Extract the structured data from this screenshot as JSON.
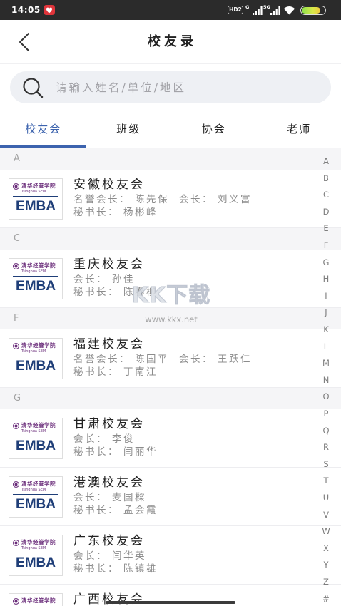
{
  "status_bar": {
    "time": "14:05",
    "notification_icon": "heart-icon",
    "hd_badge": "HD2",
    "sim1_network": "G",
    "sim1_signal_bars": 4,
    "sim2_network": "5G",
    "sim2_signal_bars": 4,
    "wifi_icon": "wifi-icon",
    "battery_level": 0.8
  },
  "header": {
    "title": "校友录",
    "back_icon": "chevron-left-icon"
  },
  "search": {
    "icon": "search-icon",
    "placeholder": "请输入姓名/单位/地区",
    "value": ""
  },
  "tabs": [
    {
      "label": "校友会",
      "active": true
    },
    {
      "label": "班级",
      "active": false
    },
    {
      "label": "协会",
      "active": false
    },
    {
      "label": "老师",
      "active": false
    }
  ],
  "logo": {
    "school": "清华经管学院",
    "english": "Tsinghua SEM",
    "program": "EMBA"
  },
  "sections": [
    {
      "letter": "A",
      "items": [
        {
          "name": "安徽校友会",
          "rows": [
            [
              {
                "label": "名誉会长：",
                "value": "陈先保"
              },
              {
                "label": "会长：",
                "value": "刘义富"
              }
            ],
            [
              {
                "label": "秘书长：",
                "value": "杨彬峰"
              }
            ]
          ]
        }
      ]
    },
    {
      "letter": "C",
      "items": [
        {
          "name": "重庆校友会",
          "rows": [
            [
              {
                "label": "会长：",
                "value": "孙佳"
              }
            ],
            [
              {
                "label": "秘书长：",
                "value": "陈春柳"
              }
            ]
          ]
        }
      ]
    },
    {
      "letter": "F",
      "items": [
        {
          "name": "福建校友会",
          "rows": [
            [
              {
                "label": "名誉会长：",
                "value": "陈国平"
              },
              {
                "label": "会长：",
                "value": "王跃仁"
              }
            ],
            [
              {
                "label": "秘书长：",
                "value": "丁南江"
              }
            ]
          ]
        }
      ]
    },
    {
      "letter": "G",
      "items": [
        {
          "name": "甘肃校友会",
          "rows": [
            [
              {
                "label": "会长：",
                "value": "李俊"
              }
            ],
            [
              {
                "label": "秘书长：",
                "value": "闫丽华"
              }
            ]
          ]
        },
        {
          "name": "港澳校友会",
          "rows": [
            [
              {
                "label": "会长：",
                "value": "麦国樑"
              }
            ],
            [
              {
                "label": "秘书长：",
                "value": "孟会霞"
              }
            ]
          ]
        },
        {
          "name": "广东校友会",
          "rows": [
            [
              {
                "label": "会长：",
                "value": "闫华英"
              }
            ],
            [
              {
                "label": "秘书长：",
                "value": "陈镇雄"
              }
            ]
          ]
        },
        {
          "name": "广西校友会",
          "rows": []
        }
      ]
    }
  ],
  "index_letters": [
    "A",
    "B",
    "C",
    "D",
    "E",
    "F",
    "G",
    "H",
    "I",
    "J",
    "K",
    "L",
    "M",
    "N",
    "O",
    "P",
    "Q",
    "R",
    "S",
    "T",
    "U",
    "V",
    "W",
    "X",
    "Y",
    "Z",
    "#"
  ],
  "watermark": {
    "brand": "KK下载",
    "url": "www.kkx.net"
  },
  "colors": {
    "accent": "#3c63ae",
    "status_bar": "#2b2b2b",
    "section_background": "#f5f5f7",
    "search_background": "#eef0f4",
    "logo_purple": "#6a2c7a",
    "logo_navy": "#1f3e78"
  }
}
